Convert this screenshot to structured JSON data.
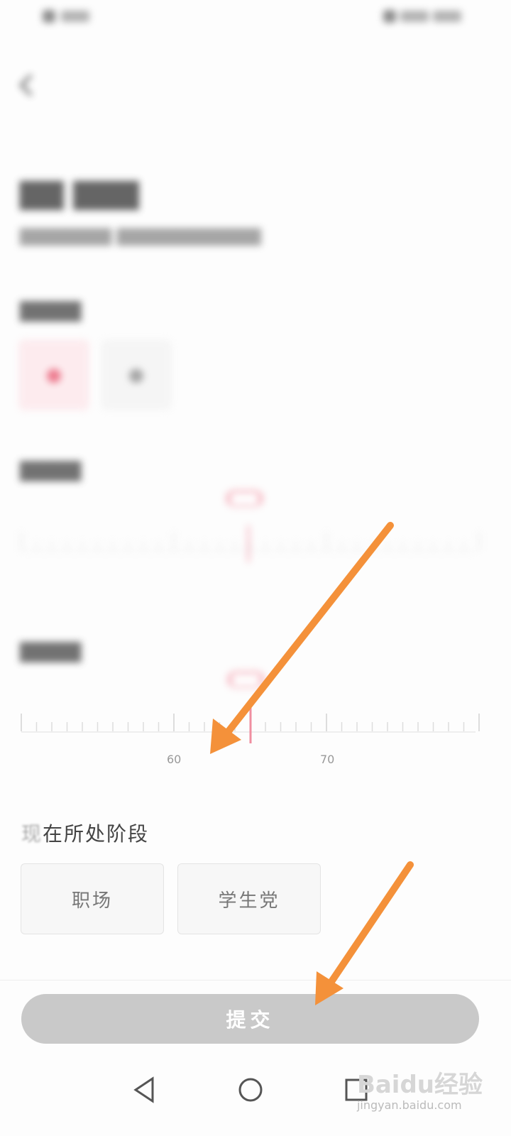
{
  "ruler_weight": {
    "labels": [
      "60",
      "70"
    ]
  },
  "stage": {
    "title_faded": "现",
    "title": "在所处阶段",
    "options": [
      {
        "label": "职场"
      },
      {
        "label": "学生党"
      }
    ]
  },
  "submit_label": "提交",
  "watermark": {
    "brand": "Baidu经验",
    "url": "jingyan.baidu.com"
  },
  "colors": {
    "accent": "#e8506a",
    "arrow": "#f4913a",
    "submit_bg": "#c9c9c9"
  }
}
